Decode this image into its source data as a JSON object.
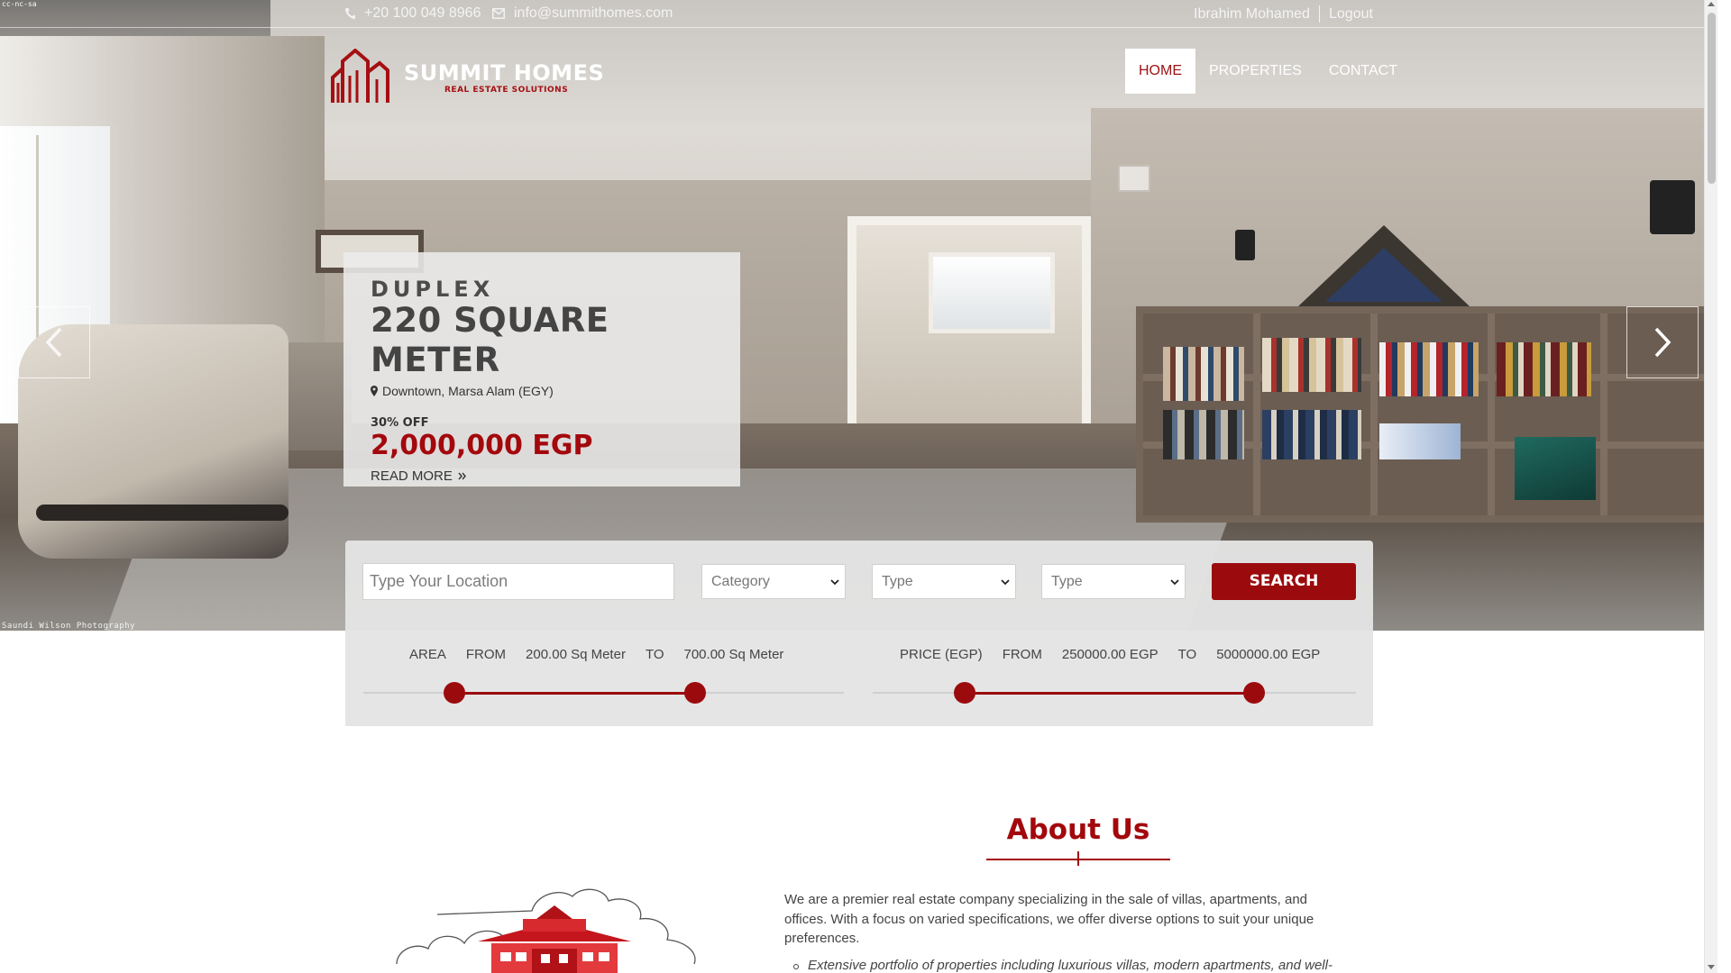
{
  "topbar": {
    "phone": "+20 100 049 8966",
    "email": "info@summithomes.com",
    "user": "Ibrahim Mohamed",
    "logout": "Logout"
  },
  "logo": {
    "title": "SUMMIT HOMES",
    "subtitle": "REAL ESTATE SOLUTIONS"
  },
  "nav": {
    "items": [
      {
        "label": "HOME",
        "active": true
      },
      {
        "label": "PROPERTIES",
        "active": false
      },
      {
        "label": "CONTACT",
        "active": false
      }
    ]
  },
  "slide": {
    "type": "DUPLEX",
    "size": "220 SQUARE METER",
    "location": "Downtown, Marsa Alam (EGY)",
    "discount": "30% OFF",
    "price": "2,000,000 EGP",
    "read_more": "READ MORE",
    "photo_credit": "Saundi Wilson Photography",
    "corner_mark": "cc-nc-sa"
  },
  "search": {
    "location_placeholder": "Type Your Location",
    "category_label": "Category",
    "type1_label": "Type",
    "type2_label": "Type",
    "button_label": "SEARCH",
    "area": {
      "label": "AREA",
      "from_label": "FROM",
      "from_value": "200.00 Sq Meter",
      "to_label": "TO",
      "to_value": "700.00 Sq Meter",
      "low_fraction": 0.19,
      "high_fraction": 0.69
    },
    "price": {
      "label": "PRICE (EGP)",
      "from_label": "FROM",
      "from_value": "250000.00 EGP",
      "to_label": "TO",
      "to_value": "5000000.00 EGP",
      "low_fraction": 0.19,
      "high_fraction": 0.79
    }
  },
  "about": {
    "title": "About Us",
    "text": "We are a premier real estate company specializing in the sale of villas, apartments, and offices. With a focus on varied specifications, we offer diverse options to suit your unique preferences.",
    "list_item_1": "Extensive portfolio of properties including luxurious villas, modern apartments, and well-"
  },
  "colors": {
    "brand_red": "#9b0b0e",
    "text_dark": "#444444"
  }
}
